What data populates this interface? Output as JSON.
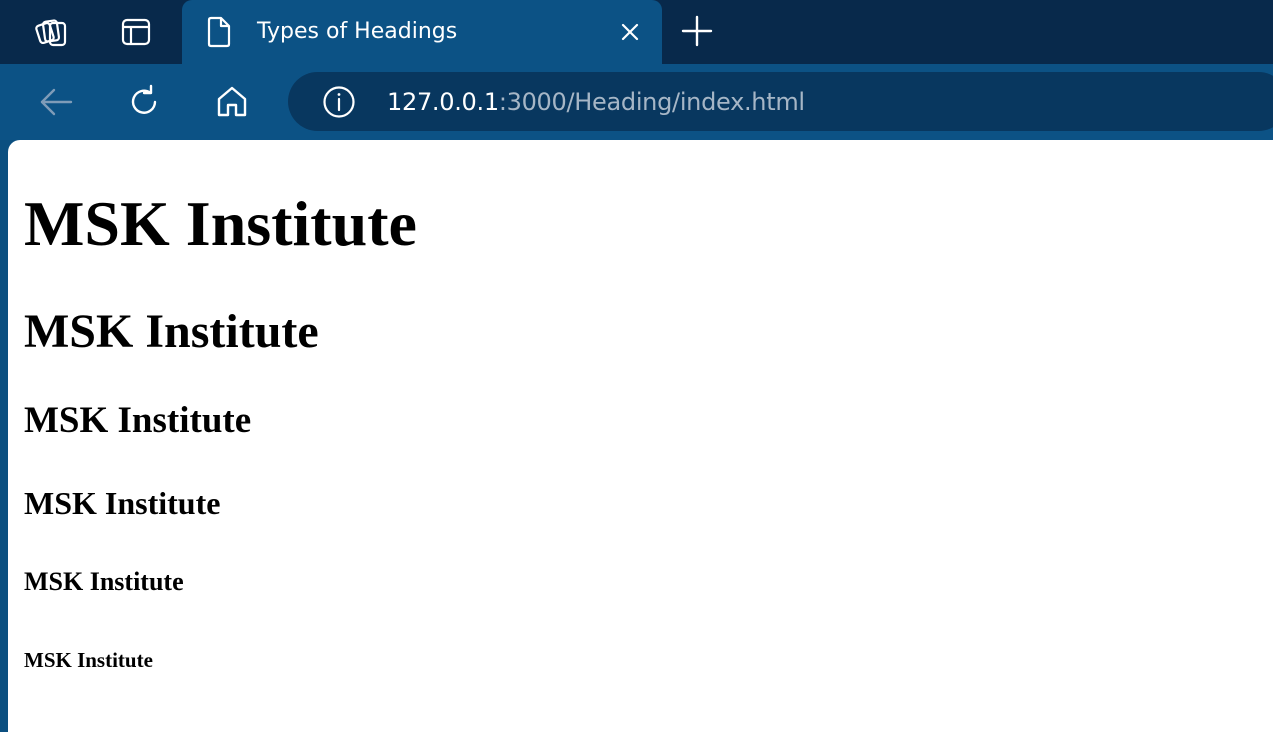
{
  "tabstrip": {
    "workspaces_icon": "workspaces-icon",
    "vertical_tabs_icon": "vertical-tabs-icon",
    "active_tab": {
      "icon": "page-icon",
      "title": "Types of Headings",
      "close_icon": "close-icon"
    },
    "new_tab_icon": "plus-icon"
  },
  "toolbar": {
    "back_icon": "back-arrow-icon",
    "reload_icon": "reload-icon",
    "home_icon": "home-icon",
    "address": {
      "info_icon": "info-icon",
      "host": "127.0.0.1",
      "rest": ":3000/Heading/index.html"
    }
  },
  "page": {
    "headings": [
      {
        "level": "h1",
        "text": "MSK Institute"
      },
      {
        "level": "h2",
        "text": "MSK Institute"
      },
      {
        "level": "h3",
        "text": "MSK Institute"
      },
      {
        "level": "h4",
        "text": "MSK Institute"
      },
      {
        "level": "h5",
        "text": "MSK Institute"
      },
      {
        "level": "h6",
        "text": "MSK Institute"
      }
    ]
  },
  "colors": {
    "tabstrip_bg": "#08294b",
    "toolbar_bg": "#0c5285",
    "addressbar_bg": "#08375f",
    "url_host": "#ffffff",
    "url_rest": "#a6b6c6",
    "content_bg": "#ffffff"
  }
}
